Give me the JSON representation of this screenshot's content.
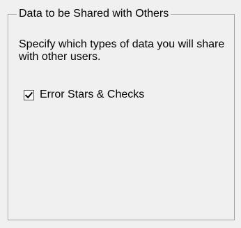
{
  "group": {
    "title": "Data to be Shared with Others",
    "description": "Specify which types of data you will share with other users."
  },
  "options": [
    {
      "label": "Error Stars & Checks",
      "checked": true,
      "icon": "checkmark-icon"
    }
  ]
}
